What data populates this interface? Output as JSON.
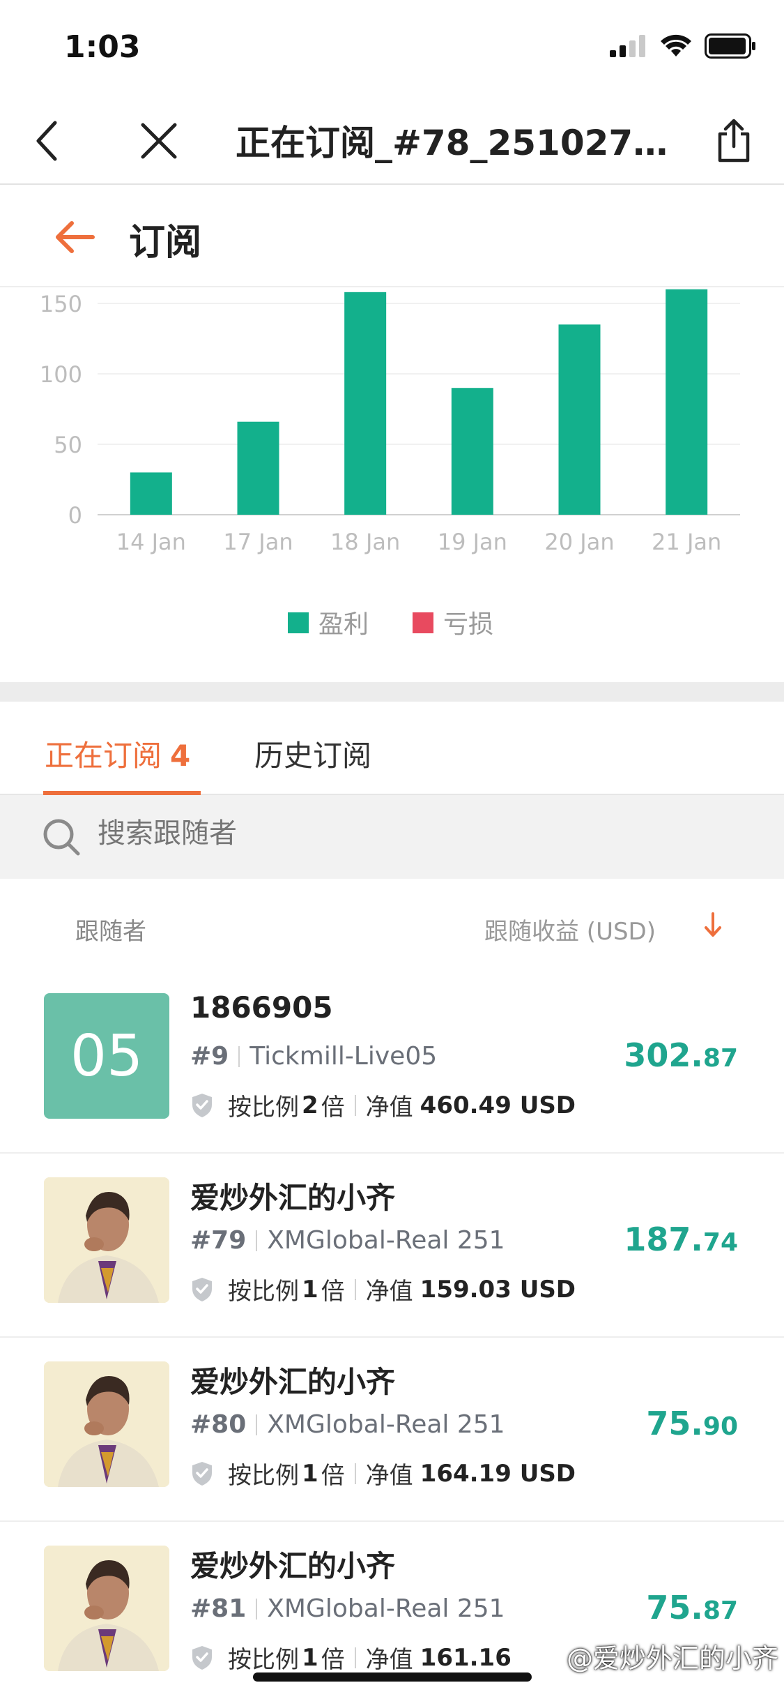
{
  "status_bar": {
    "time": "1:03"
  },
  "nav": {
    "title": "正在订阅_#78_2510279..."
  },
  "subheader": {
    "title": "订阅"
  },
  "chart_data": {
    "type": "bar",
    "categories": [
      "14 Jan",
      "17 Jan",
      "18 Jan",
      "19 Jan",
      "20 Jan",
      "21 Jan"
    ],
    "series": [
      {
        "name": "盈利",
        "values": [
          30,
          66,
          158,
          90,
          135,
          160
        ],
        "color": "#13b08c"
      },
      {
        "name": "亏损",
        "values": [
          0,
          0,
          0,
          0,
          0,
          0
        ],
        "color": "#e84a5f"
      }
    ],
    "yticks": [
      0,
      50,
      100,
      150
    ],
    "ylim": [
      0,
      160
    ],
    "grid": true,
    "legend": "bottom-center"
  },
  "tabs": {
    "active_label": "正在订阅",
    "active_count": "4",
    "inactive_label": "历史订阅"
  },
  "search": {
    "placeholder": "搜索跟随者"
  },
  "list_header": {
    "left": "跟随者",
    "right": "跟随收益 (USD)"
  },
  "followers": [
    {
      "name": "1866905",
      "avatar_text": "05",
      "rank": "#9",
      "broker": "Tickmill-Live05",
      "ratio_prefix": "按比例",
      "ratio": "2",
      "ratio_suffix": "倍",
      "equity_label": "净值",
      "equity": "460.49 USD",
      "profit_int": "302.",
      "profit_dec": "87"
    },
    {
      "name": "爱炒外汇的小齐",
      "rank": "#79",
      "broker": "XMGlobal-Real 251",
      "ratio_prefix": "按比例",
      "ratio": "1",
      "ratio_suffix": "倍",
      "equity_label": "净值",
      "equity": "159.03 USD",
      "profit_int": "187.",
      "profit_dec": "74"
    },
    {
      "name": "爱炒外汇的小齐",
      "rank": "#80",
      "broker": "XMGlobal-Real 251",
      "ratio_prefix": "按比例",
      "ratio": "1",
      "ratio_suffix": "倍",
      "equity_label": "净值",
      "equity": "164.19 USD",
      "profit_int": "75.",
      "profit_dec": "90"
    },
    {
      "name": "爱炒外汇的小齐",
      "rank": "#81",
      "broker": "XMGlobal-Real 251",
      "ratio_prefix": "按比例",
      "ratio": "1",
      "ratio_suffix": "倍",
      "equity_label": "净值",
      "equity": "161.16 ",
      "profit_int": "75.",
      "profit_dec": "87"
    }
  ],
  "watermark": "@爱炒外汇的小齐"
}
